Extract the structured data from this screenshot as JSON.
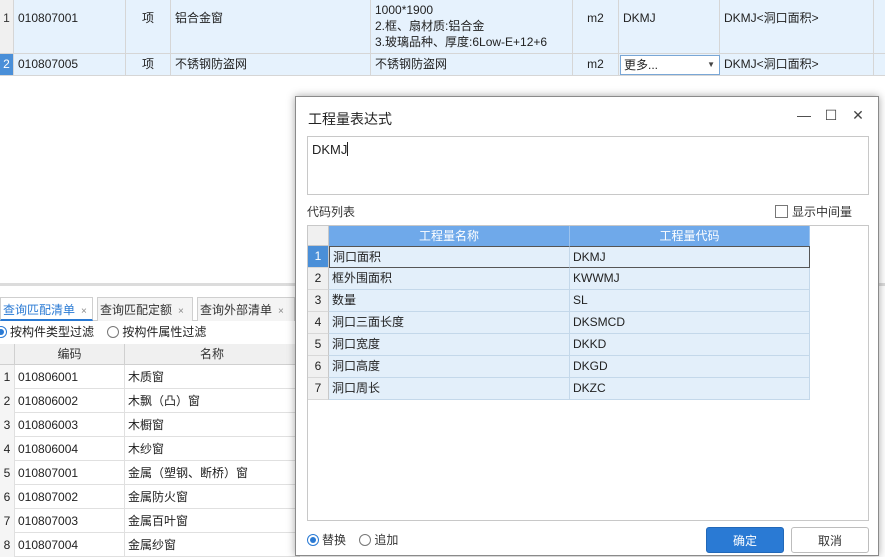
{
  "top_grid": {
    "rows": [
      {
        "index": "1",
        "code": "010807001",
        "unit_type": "项",
        "name": "铝合金窗",
        "desc_lines": [
          "1000*1900",
          "2.框、扇材质:铝合金",
          "3.玻璃品种、厚度:6Low-E+12+6"
        ],
        "unit": "m2",
        "qty_code": "DKMJ",
        "qty_expr": "DKMJ<洞口面积>"
      },
      {
        "index": "2",
        "code": "010807005",
        "unit_type": "项",
        "name": "不锈钢防盗网",
        "desc_lines": [
          "不锈钢防盗网"
        ],
        "unit": "m2",
        "qty_code": "更多...",
        "qty_expr": "DKMJ<洞口面积>"
      }
    ]
  },
  "bottom_panel": {
    "tabs": [
      {
        "label": "查询匹配清单",
        "close": "×"
      },
      {
        "label": "查询匹配定额",
        "close": "×"
      },
      {
        "label": "查询外部清单",
        "close": "×"
      }
    ],
    "filters": {
      "by_type": "按构件类型过滤",
      "by_attr": "按构件属性过滤"
    },
    "headers": {
      "code": "编码",
      "name": "名称"
    },
    "rows": [
      {
        "index": "1",
        "code": "010806001",
        "name": "木质窗"
      },
      {
        "index": "2",
        "code": "010806002",
        "name": "木飘（凸）窗"
      },
      {
        "index": "3",
        "code": "010806003",
        "name": "木橱窗"
      },
      {
        "index": "4",
        "code": "010806004",
        "name": "木纱窗"
      },
      {
        "index": "5",
        "code": "010807001",
        "name": "金属（塑钢、断桥）窗"
      },
      {
        "index": "6",
        "code": "010807002",
        "name": "金属防火窗"
      },
      {
        "index": "7",
        "code": "010807003",
        "name": "金属百叶窗"
      },
      {
        "index": "8",
        "code": "010807004",
        "name": "金属纱窗"
      }
    ]
  },
  "dialog": {
    "title": "工程量表达式",
    "window_buttons": {
      "minimize": "—",
      "maximize": "☐",
      "close": "✕"
    },
    "expression": "DKMJ",
    "codes_label": "代码列表",
    "show_intermediate": "显示中间量",
    "table_headers": {
      "name": "工程量名称",
      "code": "工程量代码"
    },
    "codes": [
      {
        "index": "1",
        "name": "洞口面积",
        "code": "DKMJ"
      },
      {
        "index": "2",
        "name": "框外围面积",
        "code": "KWWMJ"
      },
      {
        "index": "3",
        "name": "数量",
        "code": "SL"
      },
      {
        "index": "4",
        "name": "洞口三面长度",
        "code": "DKSMCD"
      },
      {
        "index": "5",
        "name": "洞口宽度",
        "code": "DKKD"
      },
      {
        "index": "6",
        "name": "洞口高度",
        "code": "DKGD"
      },
      {
        "index": "7",
        "name": "洞口周长",
        "code": "DKZC"
      }
    ],
    "mode": {
      "replace": "替换",
      "append": "追加"
    },
    "buttons": {
      "confirm": "确定",
      "cancel": "取消"
    }
  },
  "colors": {
    "accent": "#2a7ad4",
    "header_blue": "#6fa9ea",
    "row_blue": "#e3effa",
    "selected_row_header": "#4a8fd8"
  }
}
